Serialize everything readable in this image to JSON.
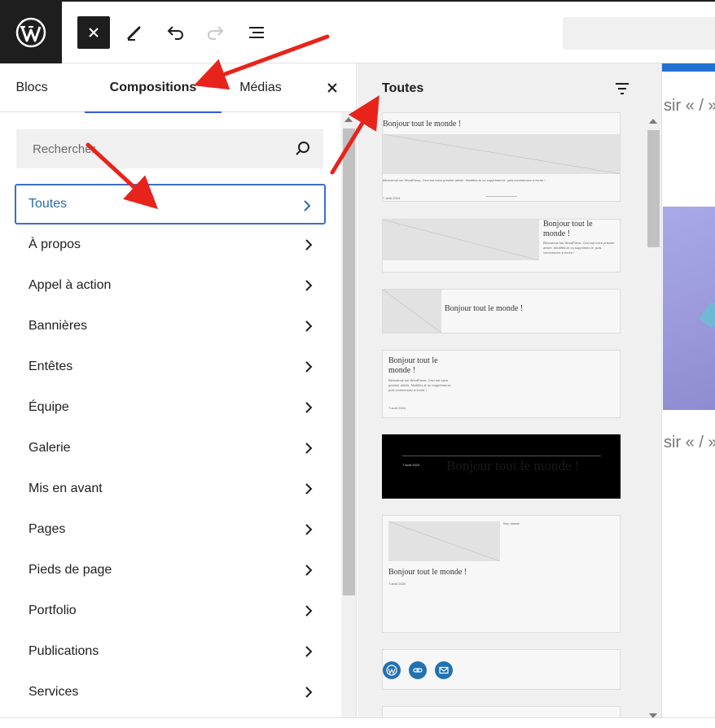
{
  "toolbar": {
    "logo_icon": "wordpress-icon",
    "close_icon": "close-icon",
    "tools_icon": "pen-icon",
    "undo_icon": "undo-icon",
    "redo_icon": "redo-icon",
    "list_view_icon": "list-view-icon"
  },
  "inserter": {
    "tabs": [
      {
        "label": "Blocs"
      },
      {
        "label": "Compositions"
      },
      {
        "label": "Médias"
      }
    ],
    "search_placeholder": "Rechercher",
    "categories": [
      {
        "label": "Toutes"
      },
      {
        "label": "À propos"
      },
      {
        "label": "Appel à action"
      },
      {
        "label": "Bannières"
      },
      {
        "label": "Entêtes"
      },
      {
        "label": "Équipe"
      },
      {
        "label": "Galerie"
      },
      {
        "label": "Mis en avant"
      },
      {
        "label": "Pages"
      },
      {
        "label": "Pieds de page"
      },
      {
        "label": "Portfolio"
      },
      {
        "label": "Publications"
      },
      {
        "label": "Services"
      }
    ]
  },
  "patterns": {
    "title": "Toutes",
    "post_title": "Bonjour tout le monde !",
    "post_title_split": [
      "Bonjour tout le",
      "monde !"
    ],
    "excerpt": "Bienvenue sur WordPress. Ceci est votre premier article. Modifiez-le ou supprimez-le, puis commencez à écrire !",
    "date": "7 août 2024",
    "category": "Non classé"
  },
  "editor": {
    "text_fragment": "sir « / »"
  },
  "colors": {
    "accent": "#3858e9",
    "selected_border": "#3b6fc4",
    "selected_text": "#2c6aa8",
    "arrow": "#e8231b",
    "social_blue": "#2271b1"
  }
}
